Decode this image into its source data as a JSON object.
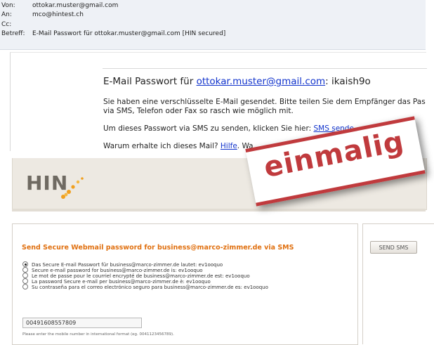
{
  "email": {
    "header": {
      "rows": [
        {
          "key": "Von:",
          "value": "ottokar.muster@gmail.com"
        },
        {
          "key": "An:",
          "value": "mco@hintest.ch"
        },
        {
          "key": "Cc:",
          "value": ""
        },
        {
          "key": "Betreff:",
          "value": "E-Mail Passwort für ottokar.muster@gmail.com [HIN secured]"
        }
      ]
    },
    "body": {
      "title_prefix": "E-Mail Passwort für ",
      "title_link": "ottokar.muster@gmail.com",
      "title_suffix": ": ikaish9o",
      "line1": "Sie haben eine verschlüsselte E-Mail gesendet. Bitte teilen Sie dem Empfänger das Pas",
      "line2": "via SMS, Telefon oder Fax so rasch wie möglich mit.",
      "line3_prefix": "Um dieses Passwort via SMS zu senden, klicken Sie hier: ",
      "line3_link": "SMS sende",
      "line4_prefix": "Warum erhalte ich dieses Mail? ",
      "line4_link": "Hilfe",
      "line4_suffix": ". Wa"
    }
  },
  "stamp": {
    "text": "einmalig",
    "color": "#c03a3d"
  },
  "hin": {
    "logo": "HIN",
    "logo_icon": "hin-dots-icon",
    "sms_panel": {
      "title": "Send Secure Webmail password for business@marco-zimmer.de via SMS",
      "options": [
        {
          "label": "Das Secure E-mail Passwort für business@marco-zimmer.de lautet: ev1ooquo",
          "selected": true
        },
        {
          "label": "Secure e-mail password for business@marco-zimmer.de is: ev1ooquo",
          "selected": false
        },
        {
          "label": "Le mot de passe pour le courriel encrypté de business@marco-zimmer.de est: ev1ooquo",
          "selected": false
        },
        {
          "label": "La password Secure e-mail per business@marco-zimmer.de è: ev1ooquo",
          "selected": false
        },
        {
          "label": "Su contraseña para el correo electrónico seguro para business@marco-zimmer.de es: ev1ooquo",
          "selected": false
        }
      ],
      "phone_value": "00491608557809",
      "hint": "Please enter the mobile number in international format (eg. 0041123456789)."
    },
    "send_button": "SEND SMS"
  },
  "colors": {
    "accent": "#e07010",
    "link": "#1133cc",
    "stamp": "#c03a3d"
  }
}
